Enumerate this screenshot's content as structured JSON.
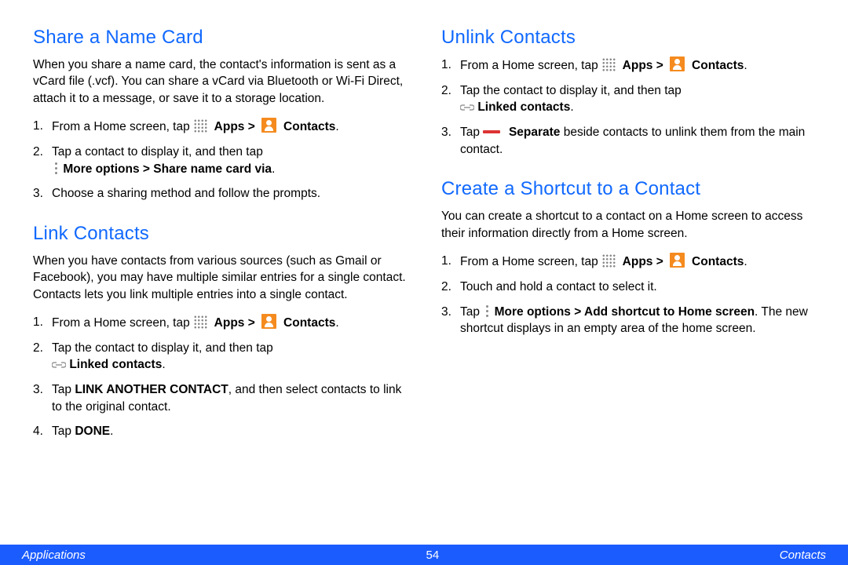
{
  "sections": {
    "share": {
      "heading": "Share a Name Card",
      "intro": "When you share a name card, the contact's information is sent as a vCard file (.vcf). You can share a vCard via Bluetooth or Wi-Fi Direct, attach it to a message, or save it to a storage location.",
      "s1_pre": "From a Home screen, tap ",
      "apps": "Apps >",
      "contacts": "Contacts",
      "s2_pre": "Tap a contact to display it, and then tap",
      "s2_bold": "More options > Share name card via",
      "s3": "Choose a sharing method and follow the prompts."
    },
    "link": {
      "heading": "Link Contacts",
      "intro": "When you have contacts from various sources (such as Gmail or Facebook), you may have multiple similar entries for a single contact. Contacts lets you link multiple entries into a single contact.",
      "s1_pre": "From a Home screen, tap ",
      "apps": "Apps >",
      "contacts": "Contacts",
      "s2_pre": "Tap the contact to display it, and then tap",
      "s2_bold": "Linked contacts",
      "s3_a": "Tap ",
      "s3_b": "LINK ANOTHER CONTACT",
      "s3_c": ", and then select contacts to link to the original contact.",
      "s4_a": "Tap ",
      "s4_b": "DONE"
    },
    "unlink": {
      "heading": "Unlink Contacts",
      "s1_pre": "From a Home screen, tap ",
      "apps": "Apps >",
      "contacts": "Contacts",
      "s2_pre": "Tap the contact to display it, and then tap",
      "s2_bold": "Linked contacts",
      "s3_a": "Tap ",
      "s3_b": "Separate",
      "s3_c": " beside contacts to unlink them from the main contact."
    },
    "shortcut": {
      "heading": "Create a Shortcut to a Contact",
      "intro": "You can create a shortcut to a contact on a Home screen to access their information directly from a Home screen.",
      "s1_pre": "From a Home screen, tap ",
      "apps": "Apps >",
      "contacts": "Contacts",
      "s2": "Touch and hold a contact to select it.",
      "s3_a": "Tap ",
      "s3_b": "More options > Add shortcut to Home screen",
      "s3_c": ". The new shortcut displays in an empty area of the home screen."
    }
  },
  "footer": {
    "left": "Applications",
    "page": "54",
    "right": "Contacts"
  },
  "period": "."
}
